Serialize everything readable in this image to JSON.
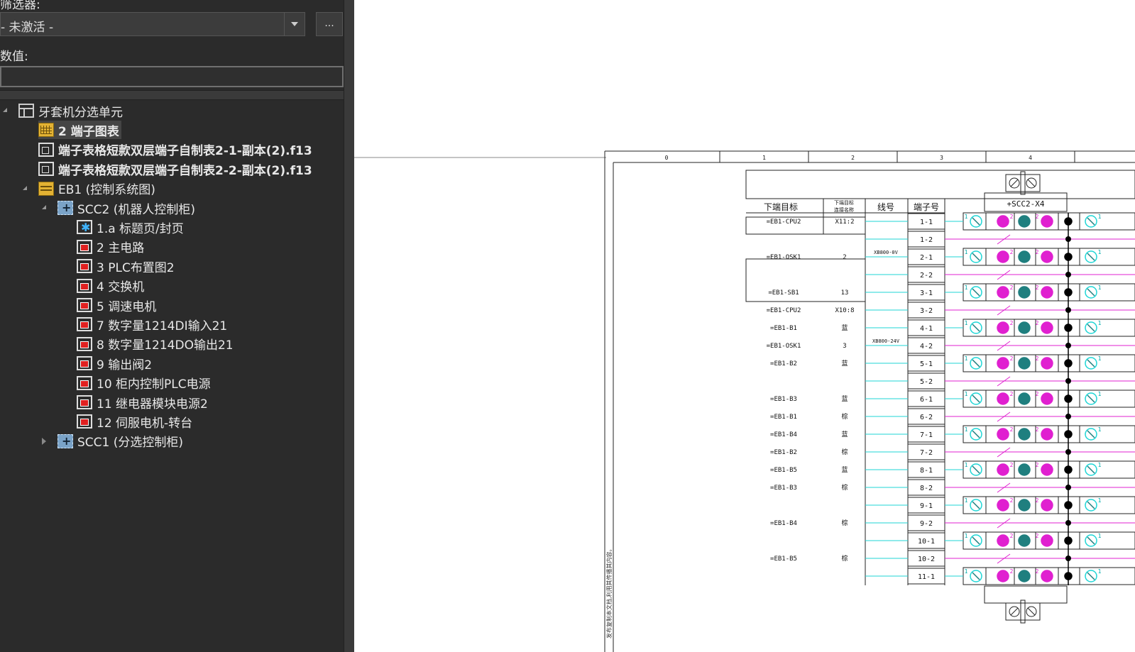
{
  "filter": {
    "label": "筛选器:",
    "value": "- 未激活 -",
    "more_label": "..."
  },
  "value_label": "数值:",
  "tree": [
    {
      "label": "牙套机分选单元",
      "icon": "layout-icon",
      "level": 0,
      "expander": "open",
      "bold": false,
      "selected": false
    },
    {
      "label": "2 端子图表",
      "icon": "table-icon",
      "level": 1,
      "expander": "none",
      "bold": true,
      "selected": true
    },
    {
      "label": "端子表格短款双层端子自制表2-1-副本(2).f13",
      "icon": "form-icon",
      "level": 1,
      "expander": "none",
      "bold": true,
      "selected": false
    },
    {
      "label": "端子表格短款双层端子自制表2-2-副本(2).f13",
      "icon": "form-icon",
      "level": 1,
      "expander": "none",
      "bold": true,
      "selected": false
    },
    {
      "label": "EB1 (控制系统图)",
      "icon": "eb-icon",
      "level": 1,
      "expander": "open",
      "bold": false,
      "selected": false
    },
    {
      "label": "SCC2 (机器人控制柜)",
      "icon": "scc-icon",
      "level": 2,
      "expander": "open",
      "bold": false,
      "selected": false
    },
    {
      "label": "1.a 标题页/封页",
      "icon": "title-page-icon",
      "level": 3,
      "expander": "none",
      "bold": false,
      "selected": false
    },
    {
      "label": "2 主电路",
      "icon": "page-icon",
      "level": 3,
      "expander": "none",
      "bold": false,
      "selected": false
    },
    {
      "label": "3 PLC布置图2",
      "icon": "page-icon",
      "level": 3,
      "expander": "none",
      "bold": false,
      "selected": false
    },
    {
      "label": "4 交换机",
      "icon": "page-icon",
      "level": 3,
      "expander": "none",
      "bold": false,
      "selected": false
    },
    {
      "label": "5 调速电机",
      "icon": "page-icon",
      "level": 3,
      "expander": "none",
      "bold": false,
      "selected": false
    },
    {
      "label": "7 数字量1214DI输入21",
      "icon": "page-icon",
      "level": 3,
      "expander": "none",
      "bold": false,
      "selected": false
    },
    {
      "label": "8 数字量1214DO输出21",
      "icon": "page-icon",
      "level": 3,
      "expander": "none",
      "bold": false,
      "selected": false
    },
    {
      "label": "9 输出阀2",
      "icon": "page-icon",
      "level": 3,
      "expander": "none",
      "bold": false,
      "selected": false
    },
    {
      "label": "10 柜内控制PLC电源",
      "icon": "page-icon",
      "level": 3,
      "expander": "none",
      "bold": false,
      "selected": false
    },
    {
      "label": "11 继电器模块电源2",
      "icon": "page-icon",
      "level": 3,
      "expander": "none",
      "bold": false,
      "selected": false
    },
    {
      "label": "12 伺服电机-转台",
      "icon": "page-icon",
      "level": 3,
      "expander": "none",
      "bold": false,
      "selected": false
    },
    {
      "label": "SCC1 (分选控制柜)",
      "icon": "scc-icon",
      "level": 2,
      "expander": "closed",
      "bold": false,
      "selected": false
    }
  ],
  "drawing": {
    "columns": [
      "0",
      "1",
      "2",
      "3",
      "4"
    ],
    "headers": {
      "target": "下端目标",
      "target_conn": "下端目标\n连接名称",
      "wire": "线号",
      "terminal": "端子号"
    },
    "strip_name": "+SCC2-X4",
    "wire_labels": [
      "XB800-0V",
      "XB800-24V"
    ],
    "rows": [
      {
        "target": "=EB1-CPU2",
        "conn": "X11:2",
        "terminal": "1-1"
      },
      {
        "target": "",
        "conn": "",
        "terminal": "1-2"
      },
      {
        "target": "=EB1-OSK1",
        "conn": "2",
        "terminal": "2-1"
      },
      {
        "target": "",
        "conn": "",
        "terminal": "2-2"
      },
      {
        "target": "=EB1-SB1",
        "conn": "13",
        "terminal": "3-1"
      },
      {
        "target": "=EB1-CPU2",
        "conn": "X10:8",
        "terminal": "3-2"
      },
      {
        "target": "=EB1-B1",
        "conn": "蓝",
        "terminal": "4-1"
      },
      {
        "target": "=EB1-OSK1",
        "conn": "3",
        "terminal": "4-2"
      },
      {
        "target": "=EB1-B2",
        "conn": "蓝",
        "terminal": "5-1"
      },
      {
        "target": "",
        "conn": "",
        "terminal": "5-2"
      },
      {
        "target": "=EB1-B3",
        "conn": "蓝",
        "terminal": "6-1"
      },
      {
        "target": "=EB1-B1",
        "conn": "棕",
        "terminal": "6-2"
      },
      {
        "target": "=EB1-B4",
        "conn": "蓝",
        "terminal": "7-1"
      },
      {
        "target": "=EB1-B2",
        "conn": "棕",
        "terminal": "7-2"
      },
      {
        "target": "=EB1-B5",
        "conn": "蓝",
        "terminal": "8-1"
      },
      {
        "target": "=EB1-B3",
        "conn": "棕",
        "terminal": "8-2"
      },
      {
        "target": "",
        "conn": "",
        "terminal": "9-1"
      },
      {
        "target": "=EB1-B4",
        "conn": "棕",
        "terminal": "9-2"
      },
      {
        "target": "",
        "conn": "",
        "terminal": "10-1"
      },
      {
        "target": "=EB1-B5",
        "conn": "棕",
        "terminal": "10-2"
      },
      {
        "target": "",
        "conn": "",
        "terminal": "11-1"
      }
    ],
    "level_numbers": {
      "outer": "1",
      "inner": "2"
    },
    "vertical_note": "发布复制本文档,利用其传播其内容。",
    "colors": {
      "cyan": "#1fd6d6",
      "magenta": "#e020d0",
      "teal": "#1f7f7f",
      "line": "#222222"
    }
  }
}
